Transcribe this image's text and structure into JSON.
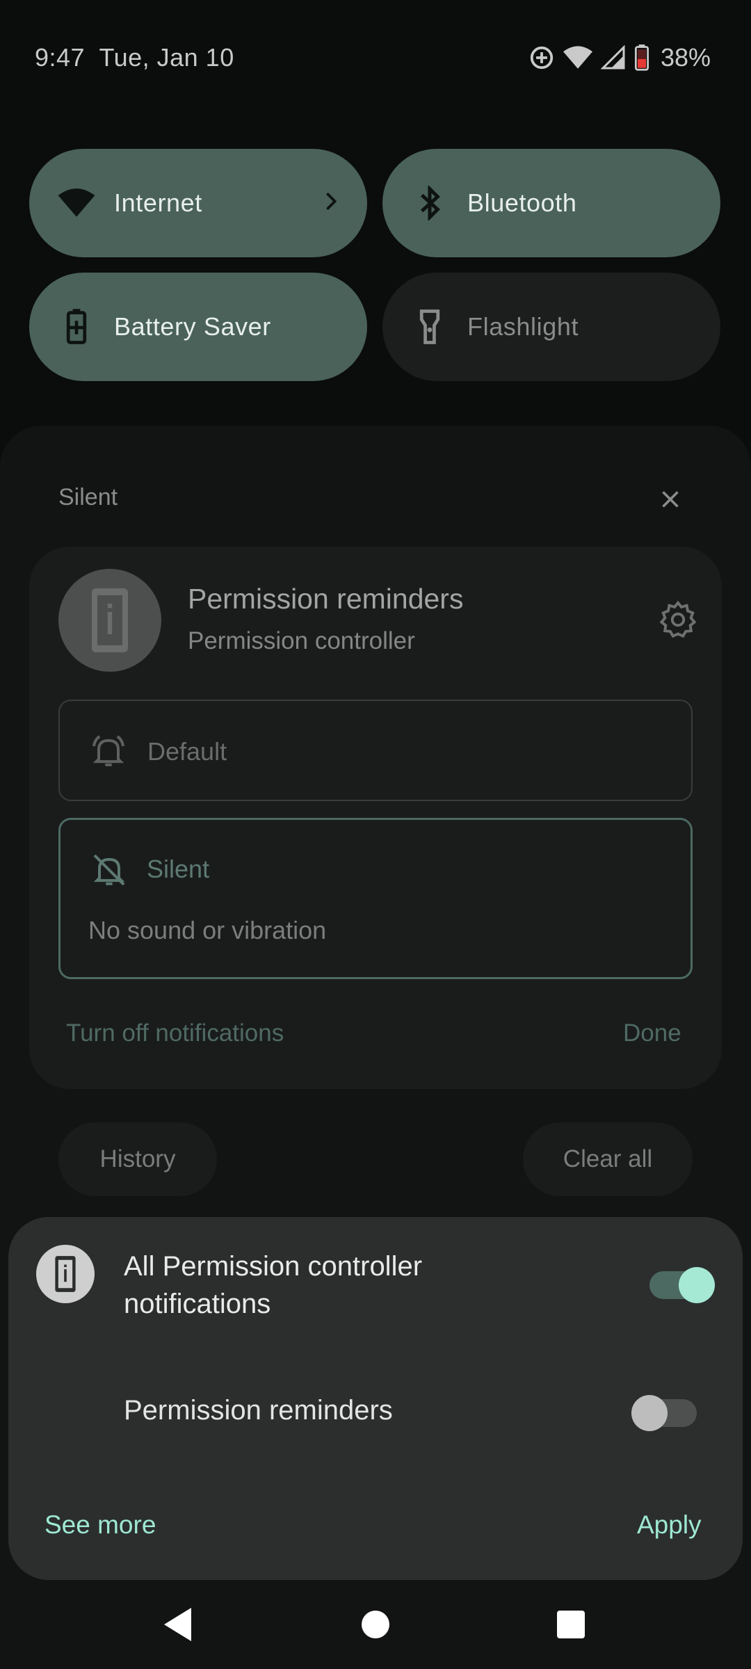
{
  "status_bar": {
    "time": "9:47",
    "date": "Tue, Jan 10",
    "battery": "38%",
    "icons": [
      "data-saver-icon",
      "wifi-icon",
      "cell-signal-icon",
      "battery-icon"
    ]
  },
  "tiles": {
    "internet": "Internet",
    "bluetooth": "Bluetooth",
    "battery_saver": "Battery Saver",
    "flashlight": "Flashlight"
  },
  "shade": {
    "section_header": "Silent",
    "notification": {
      "title": "Permission reminders",
      "subtitle": "Permission controller",
      "option_default": "Default",
      "option_silent": "Silent",
      "option_silent_desc": "No sound or vibration",
      "turn_off": "Turn off notifications",
      "done": "Done"
    },
    "history": "History",
    "clear_all": "Clear all"
  },
  "dialog": {
    "title": "All Permission controller notifications",
    "all_enabled": true,
    "row_label": "Permission reminders",
    "row_enabled": false,
    "see_more": "See more",
    "apply": "Apply"
  },
  "colors": {
    "accent": "#9ee8d2",
    "tile_on": "#4a625a",
    "tile_off": "#1c1d1d",
    "dialog_bg": "#2c2e2e"
  }
}
